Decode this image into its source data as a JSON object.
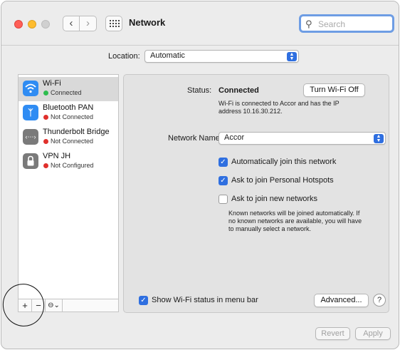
{
  "window": {
    "title": "Network",
    "search_placeholder": "Search"
  },
  "toolbar": {
    "back_glyph": "‹",
    "forward_glyph": "›",
    "search_icon": "magnifying-glass"
  },
  "location": {
    "label": "Location:",
    "value": "Automatic"
  },
  "services": [
    {
      "name": "Wi-Fi",
      "status": "Connected",
      "status_color": "#2dbd4e",
      "icon": "wifi",
      "icon_bg": "#2f8cf3",
      "selected": true
    },
    {
      "name": "Bluetooth PAN",
      "status": "Not Connected",
      "status_color": "#e0302c",
      "icon": "bluetooth",
      "icon_bg": "#2f8cf3",
      "selected": false
    },
    {
      "name": "Thunderbolt Bridge",
      "status": "Not Connected",
      "status_color": "#e0302c",
      "icon": "thunderbolt-bridge",
      "icon_bg": "#7a7a7a",
      "selected": false
    },
    {
      "name": "VPN JH",
      "status": "Not Configured",
      "status_color": "#e0302c",
      "icon": "lock",
      "icon_bg": "#7a7a7a",
      "selected": false
    }
  ],
  "sidebar_tools": {
    "add": "+",
    "remove": "−",
    "action": "⊖⌄"
  },
  "detail": {
    "status_label": "Status:",
    "status_value": "Connected",
    "turn_off_button": "Turn Wi-Fi Off",
    "status_desc_line1": "Wi-Fi is connected to Accor and has the IP",
    "status_desc_line2": "address 10.16.30.212.",
    "network_name_label": "Network Name:",
    "network_name_value": "Accor",
    "checks": [
      {
        "label": "Automatically join this network",
        "checked": true
      },
      {
        "label": "Ask to join Personal Hotspots",
        "checked": true
      },
      {
        "label": "Ask to join new networks",
        "checked": false
      }
    ],
    "known_note_line1": "Known networks will be joined automatically. If",
    "known_note_line2": "no known networks are available, you will have",
    "known_note_line3": "to manually select a network."
  },
  "bottom": {
    "show_status_label": "Show Wi-Fi status in menu bar",
    "show_status_checked": true,
    "advanced_button": "Advanced...",
    "help_button": "?",
    "revert_button": "Revert",
    "apply_button": "Apply"
  },
  "colors": {
    "accent": "#2f6fe0",
    "connected": "#2dbd4e",
    "not_connected": "#e0302c",
    "close": "#ff5f57",
    "minimize": "#febc2e"
  }
}
